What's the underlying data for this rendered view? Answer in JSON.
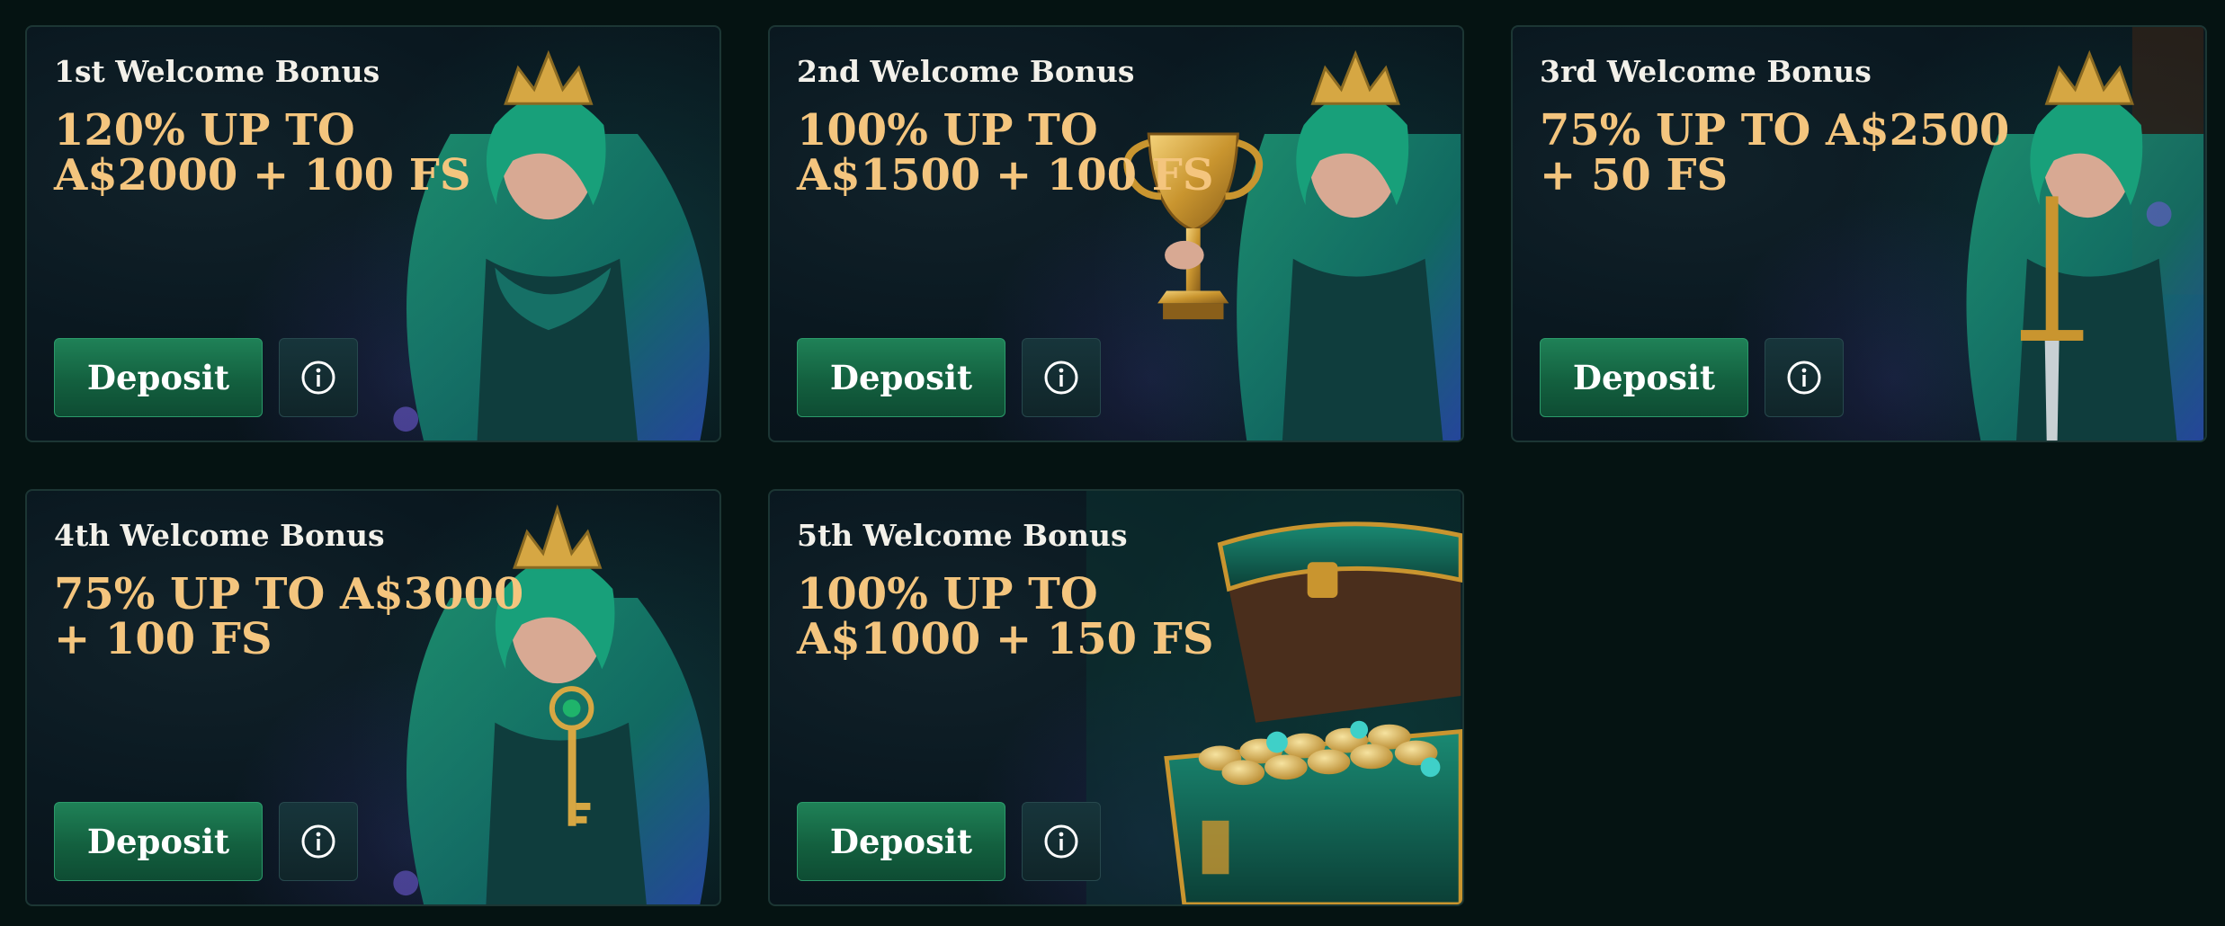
{
  "bonuses": [
    {
      "title": "1st Welcome Bonus",
      "offer": "120% UP TO\nA$2000 + 100 FS",
      "deposit_label": "Deposit",
      "info_icon": "info-icon",
      "art": "elf-queen"
    },
    {
      "title": "2nd Welcome Bonus",
      "offer": "100% UP TO\nA$1500 + 100 FS",
      "deposit_label": "Deposit",
      "info_icon": "info-icon",
      "art": "elf-queen-trophy"
    },
    {
      "title": "3rd Welcome Bonus",
      "offer": "75% UP TO A$2500\n+ 50 FS",
      "deposit_label": "Deposit",
      "info_icon": "info-icon",
      "art": "elf-queen-sword"
    },
    {
      "title": "4th Welcome Bonus",
      "offer": "75% UP TO A$3000\n+ 100 FS",
      "deposit_label": "Deposit",
      "info_icon": "info-icon",
      "art": "elf-queen-key"
    },
    {
      "title": "5th Welcome Bonus",
      "offer": "100% UP TO\nA$1000 + 150 FS",
      "deposit_label": "Deposit",
      "info_icon": "info-icon",
      "art": "treasure-chest"
    }
  ],
  "colors": {
    "page_bg": "#051312",
    "offer_text": "#f4c57e",
    "title_text": "#f3f1ea",
    "deposit_button": "#1a7350"
  }
}
